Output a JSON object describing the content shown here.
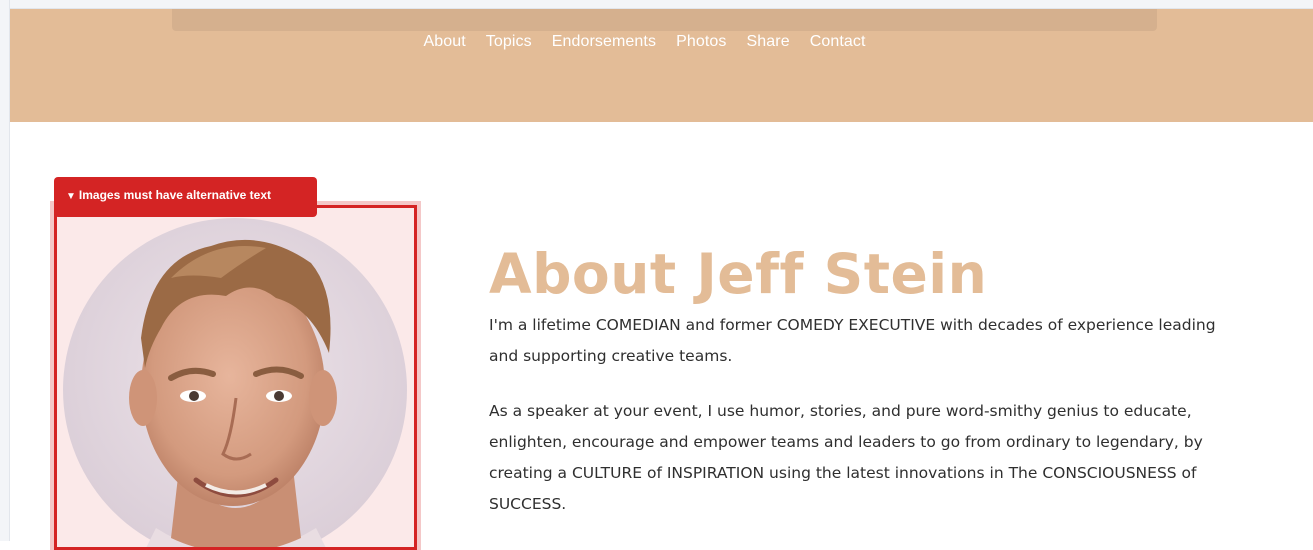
{
  "nav": {
    "items": [
      "About",
      "Topics",
      "Endorsements",
      "Photos",
      "Share",
      "Contact"
    ]
  },
  "alert": {
    "icon": "triangle-down-icon",
    "text": "Images must have alternative text"
  },
  "about": {
    "title": "About Jeff Stein",
    "paragraphs": [
      "I'm a lifetime COMEDIAN and former COMEDY EXECUTIVE with decades of experience leading and supporting creative teams.",
      "As a speaker at your event, I use humor, stories, and pure word-smithy genius to educate, enlighten, encourage and empower teams and leaders to go from ordinary to legendary, by creating a CULTURE of INSPIRATION using the latest innovations in The CONSCIOUSNESS of SUCCESS."
    ]
  },
  "colors": {
    "header": "#e3bc97",
    "title": "#e3bc97",
    "alert": "#d42424",
    "text": "#2f2f2f"
  }
}
